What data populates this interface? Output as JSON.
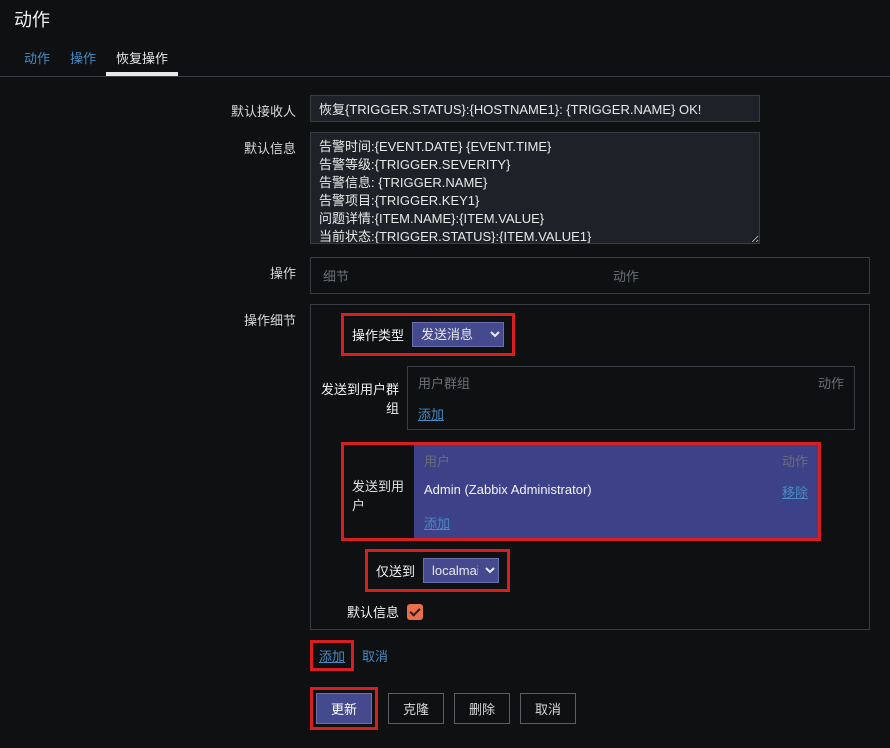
{
  "page": {
    "title": "动作"
  },
  "tabs": [
    {
      "label": "动作",
      "active": false
    },
    {
      "label": "操作",
      "active": false
    },
    {
      "label": "恢复操作",
      "active": true
    }
  ],
  "form": {
    "default_recipient_label": "默认接收人",
    "default_recipient_value": "恢复{TRIGGER.STATUS}:{HOSTNAME1}: {TRIGGER.NAME} OK!",
    "default_message_label": "默认信息",
    "default_message_value": "告警时间:{EVENT.DATE} {EVENT.TIME}\n告警等级:{TRIGGER.SEVERITY}\n告警信息: {TRIGGER.NAME}\n告警项目:{TRIGGER.KEY1}\n问题详情:{ITEM.NAME}:{ITEM.VALUE}\n当前状态:{TRIGGER.STATUS}:{ITEM.VALUE1}",
    "operations_label": "操作",
    "operations_head": {
      "details": "细节",
      "action": "动作"
    },
    "operation_details_label": "操作细节",
    "op_type_label": "操作类型",
    "op_type_value": "发送消息",
    "send_to_groups_label": "发送到用户群组",
    "groups_head": {
      "col1": "用户群组",
      "col2": "动作"
    },
    "groups_add": "添加",
    "send_to_users_label": "发送到用户",
    "users_head": {
      "col1": "用户",
      "col2": "动作"
    },
    "users_row": {
      "name": "Admin (Zabbix Administrator)",
      "remove": "移除"
    },
    "users_add": "添加",
    "send_only_to_label": "仅送到",
    "send_only_to_value": "localmail",
    "default_info_label": "默认信息",
    "default_info_checked": true,
    "add_link": "添加",
    "cancel_link": "取消"
  },
  "buttons": {
    "update": "更新",
    "clone": "克隆",
    "delete": "删除",
    "cancel": "取消"
  },
  "colors": {
    "hl": "#d81e1e",
    "accent": "#e96f4a",
    "select_bg": "#454a8f"
  }
}
